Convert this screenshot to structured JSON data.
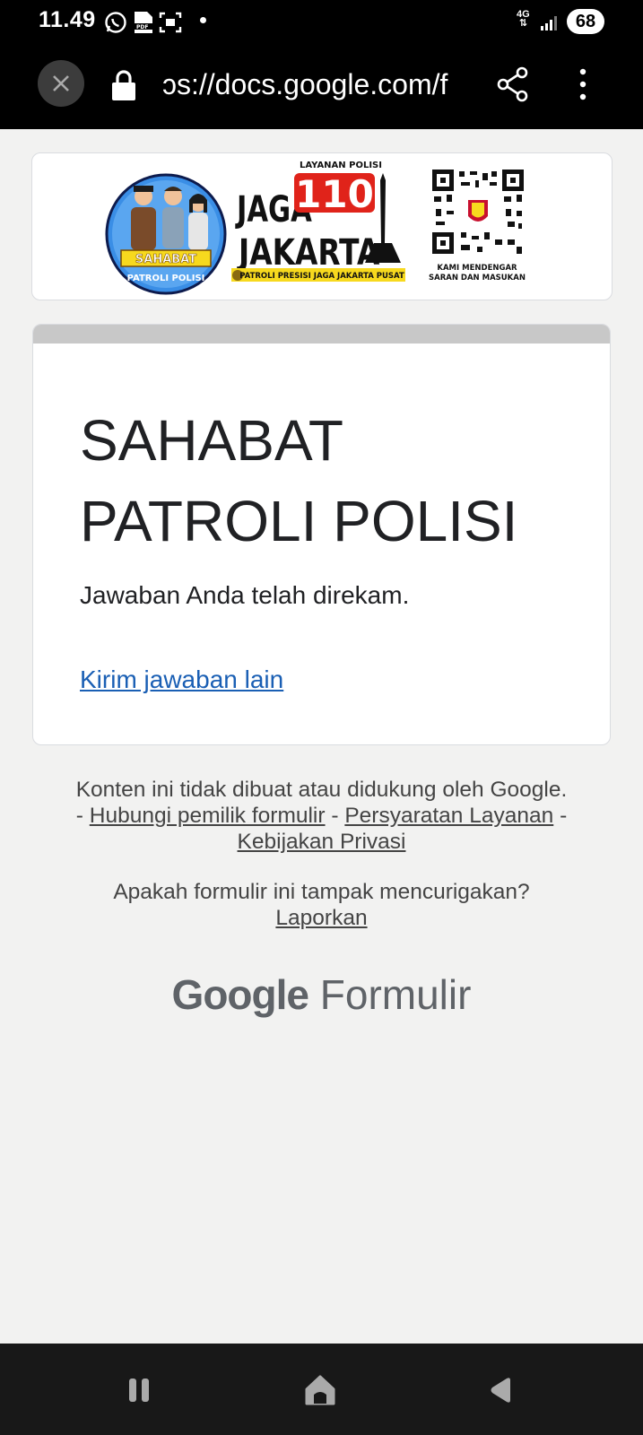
{
  "status_bar": {
    "time": "11.49",
    "network": "4G",
    "battery": "68",
    "icons": [
      "whatsapp-icon",
      "pdf-icon",
      "screenshot-icon",
      "notification-dot",
      "signal-icon"
    ]
  },
  "browser": {
    "url": "ɔs://docs.google.com/f",
    "icons": [
      "close-icon",
      "lock-icon",
      "share-icon",
      "more-vert-icon"
    ]
  },
  "banner": {
    "badge_top": "SAHABAT",
    "badge_bottom": "PATROLI POLISI",
    "service": "LAYANAN POLISI",
    "number": "110",
    "brand_line1": "JAGA",
    "brand_line2": "JAKARTA",
    "tagline": "PATROLI PRESISI JAGA JAKARTA PUSAT",
    "qr_caption_1": "KAMI MENDENGAR",
    "qr_caption_2": "SARAN DAN MASUKAN"
  },
  "form": {
    "title": "SAHABAT PATROLI POLISI",
    "message": "Jawaban Anda telah direkam.",
    "link": "Kirim jawaban lain"
  },
  "footer": {
    "disclaimer": "Konten ini tidak dibuat atau didukung oleh Google.",
    "dash1": "-",
    "contact_owner": "Hubungi pemilik formulir",
    "dash2": "-",
    "terms": "Persyaratan Layanan",
    "dash3": "-",
    "privacy": "Kebijakan Privasi",
    "suspicious_q": "Apakah formulir ini tampak mencurigakan?",
    "report": "Laporkan",
    "brand_google": "Google",
    "brand_forms": "Formulir"
  },
  "colors": {
    "accent_link": "#1a5fb4",
    "card_header": "#c8c8c8",
    "page_bg": "#f2f2f1",
    "badge_blue": "#3a8ee6",
    "badge_yellow": "#f7d91e",
    "number_red": "#e0231a"
  }
}
